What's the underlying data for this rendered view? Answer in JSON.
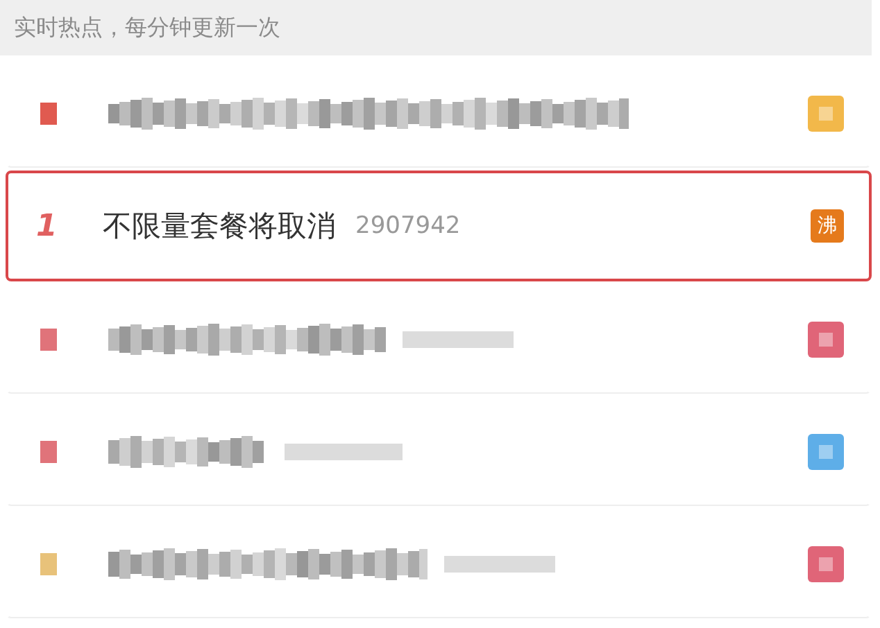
{
  "header": {
    "text": "实时热点，每分钟更新一次"
  },
  "rows": [
    {
      "kind": "blurred",
      "selected": false,
      "rank_mark": {
        "color": "#e05a50"
      },
      "badge": {
        "color": "#f2b84a"
      },
      "has_count": false
    },
    {
      "kind": "clear",
      "selected": true,
      "rank": "1",
      "title": "不限量套餐将取消",
      "count": "2907942",
      "badge": {
        "label": "沸",
        "color": "#e57a1c"
      }
    },
    {
      "kind": "blurred",
      "selected": false,
      "rank_mark": {
        "color": "#e0737a"
      },
      "badge": {
        "color": "#e06578"
      },
      "has_count": true
    },
    {
      "kind": "blurred",
      "selected": false,
      "rank_mark": {
        "color": "#e0737a"
      },
      "badge": {
        "color": "#5eaee8"
      },
      "has_count": true
    },
    {
      "kind": "blurred",
      "selected": false,
      "rank_mark": {
        "color": "#e8c27a"
      },
      "badge": {
        "color": "#e06578"
      },
      "has_count": true
    }
  ]
}
